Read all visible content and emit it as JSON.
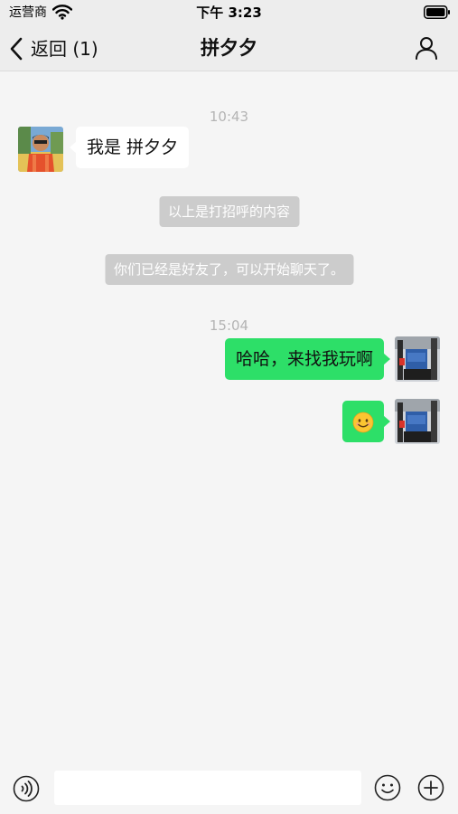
{
  "status_bar": {
    "carrier": "运营商",
    "time": "下午 3:23",
    "wifi_icon": "wifi-icon",
    "battery_icon": "battery-icon"
  },
  "nav": {
    "back_label": "返回 (1)",
    "title": "拼夕夕",
    "back_icon": "chevron-left-icon",
    "profile_icon": "person-icon"
  },
  "messages": {
    "ts1": "10:43",
    "incoming_1": "我是 拼夕夕",
    "system_1": "以上是打招呼的内容",
    "system_2": "你们已经是好友了，可以开始聊天了。",
    "ts2": "15:04",
    "outgoing_1": "哈哈，来找我玩啊",
    "outgoing_2_emoji": "smiling-face-emoji"
  },
  "input_bar": {
    "voice_icon": "voice-icon",
    "input_value": "",
    "emoji_icon": "emoji-icon",
    "plus_icon": "plus-icon"
  },
  "colors": {
    "outgoing_bubble": "#2ddf68",
    "incoming_bubble": "#ffffff",
    "system_bg": "#cccccc",
    "background": "#f5f5f5",
    "nav_bg": "#ededed"
  }
}
